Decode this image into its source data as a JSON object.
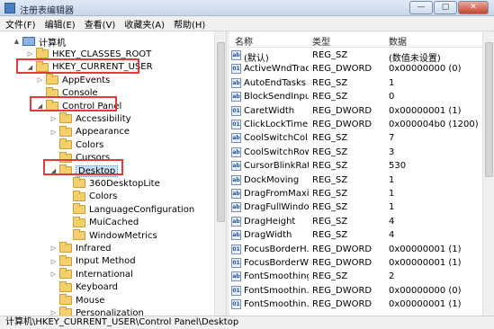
{
  "window": {
    "title": "注册表编辑器",
    "buttons": [
      "—",
      "▢",
      "✕"
    ]
  },
  "menu": [
    "文件(F)",
    "编辑(E)",
    "查看(V)",
    "收藏夹(A)",
    "帮助(H)"
  ],
  "tree": [
    {
      "label": "计算机",
      "icon": "computer-icon",
      "arrow": "▲"
    },
    {
      "label": "HKEY_CLASSES_ROOT",
      "icon": "folder-icon",
      "arrow": "▷"
    },
    {
      "label": "HKEY_CURRENT_USER",
      "icon": "folder-icon",
      "arrow": "◢"
    },
    {
      "label": "AppEvents",
      "icon": "folder-icon",
      "arrow": "▷"
    },
    {
      "label": "Console",
      "icon": "folder-icon",
      "arrow": ""
    },
    {
      "label": "Control Panel",
      "icon": "folder-icon",
      "arrow": "◢"
    },
    {
      "label": "Accessibility",
      "icon": "folder-icon",
      "arrow": "▷"
    },
    {
      "label": "Appearance",
      "icon": "folder-icon",
      "arrow": "▷"
    },
    {
      "label": "Colors",
      "icon": "folder-icon",
      "arrow": ""
    },
    {
      "label": "Cursors",
      "icon": "folder-icon",
      "arrow": ""
    },
    {
      "label": "Desktop",
      "icon": "folder-icon",
      "arrow": "◢"
    },
    {
      "label": "360DesktopLite",
      "icon": "folder-icon",
      "arrow": ""
    },
    {
      "label": "Colors",
      "icon": "folder-icon",
      "arrow": ""
    },
    {
      "label": "LanguageConfiguration",
      "icon": "folder-icon",
      "arrow": ""
    },
    {
      "label": "MuiCached",
      "icon": "folder-icon",
      "arrow": ""
    },
    {
      "label": "WindowMetrics",
      "icon": "folder-icon",
      "arrow": ""
    },
    {
      "label": "Infrared",
      "icon": "folder-icon",
      "arrow": "▷"
    },
    {
      "label": "Input Method",
      "icon": "folder-icon",
      "arrow": "▷"
    },
    {
      "label": "International",
      "icon": "folder-icon",
      "arrow": "▷"
    },
    {
      "label": "Keyboard",
      "icon": "folder-icon",
      "arrow": ""
    },
    {
      "label": "Mouse",
      "icon": "folder-icon",
      "arrow": ""
    },
    {
      "label": "Personalization",
      "icon": "folder-icon",
      "arrow": "▷"
    }
  ],
  "list": {
    "headers": [
      "名称",
      "类型",
      "数据"
    ],
    "rows": [
      {
        "icon": "ab",
        "name": "(默认)",
        "type": "REG_SZ",
        "data": "(数值未设置)"
      },
      {
        "icon": "01",
        "name": "ActiveWndTrac...",
        "type": "REG_DWORD",
        "data": "0x00000000 (0)"
      },
      {
        "icon": "ab",
        "name": "AutoEndTasks",
        "type": "REG_SZ",
        "data": "1"
      },
      {
        "icon": "ab",
        "name": "BlockSendInpu...",
        "type": "REG_SZ",
        "data": "0"
      },
      {
        "icon": "01",
        "name": "CaretWidth",
        "type": "REG_DWORD",
        "data": "0x00000001 (1)"
      },
      {
        "icon": "01",
        "name": "ClickLockTime",
        "type": "REG_DWORD",
        "data": "0x000004b0 (1200)"
      },
      {
        "icon": "ab",
        "name": "CoolSwitchCol...",
        "type": "REG_SZ",
        "data": "7"
      },
      {
        "icon": "ab",
        "name": "CoolSwitchRows",
        "type": "REG_SZ",
        "data": "3"
      },
      {
        "icon": "ab",
        "name": "CursorBlinkRate",
        "type": "REG_SZ",
        "data": "530"
      },
      {
        "icon": "ab",
        "name": "DockMoving",
        "type": "REG_SZ",
        "data": "1"
      },
      {
        "icon": "ab",
        "name": "DragFromMaxi...",
        "type": "REG_SZ",
        "data": "1"
      },
      {
        "icon": "ab",
        "name": "DragFullWindo...",
        "type": "REG_SZ",
        "data": "1"
      },
      {
        "icon": "ab",
        "name": "DragHeight",
        "type": "REG_SZ",
        "data": "4"
      },
      {
        "icon": "ab",
        "name": "DragWidth",
        "type": "REG_SZ",
        "data": "4"
      },
      {
        "icon": "01",
        "name": "FocusBorderH...",
        "type": "REG_DWORD",
        "data": "0x00000001 (1)"
      },
      {
        "icon": "01",
        "name": "FocusBorderW...",
        "type": "REG_DWORD",
        "data": "0x00000001 (1)"
      },
      {
        "icon": "ab",
        "name": "FontSmoothing",
        "type": "REG_SZ",
        "data": "2"
      },
      {
        "icon": "01",
        "name": "FontSmoothin...",
        "type": "REG_DWORD",
        "data": "0x00000000 (0)"
      },
      {
        "icon": "01",
        "name": "FontSmoothin...",
        "type": "REG_DWORD",
        "data": "0x00000001 (1)"
      }
    ]
  },
  "status": "计算机\\HKEY_CURRENT_USER\\Control Panel\\Desktop",
  "colors": {
    "highlight_box": "#e03a3a",
    "folder": "#f5cf6b"
  }
}
